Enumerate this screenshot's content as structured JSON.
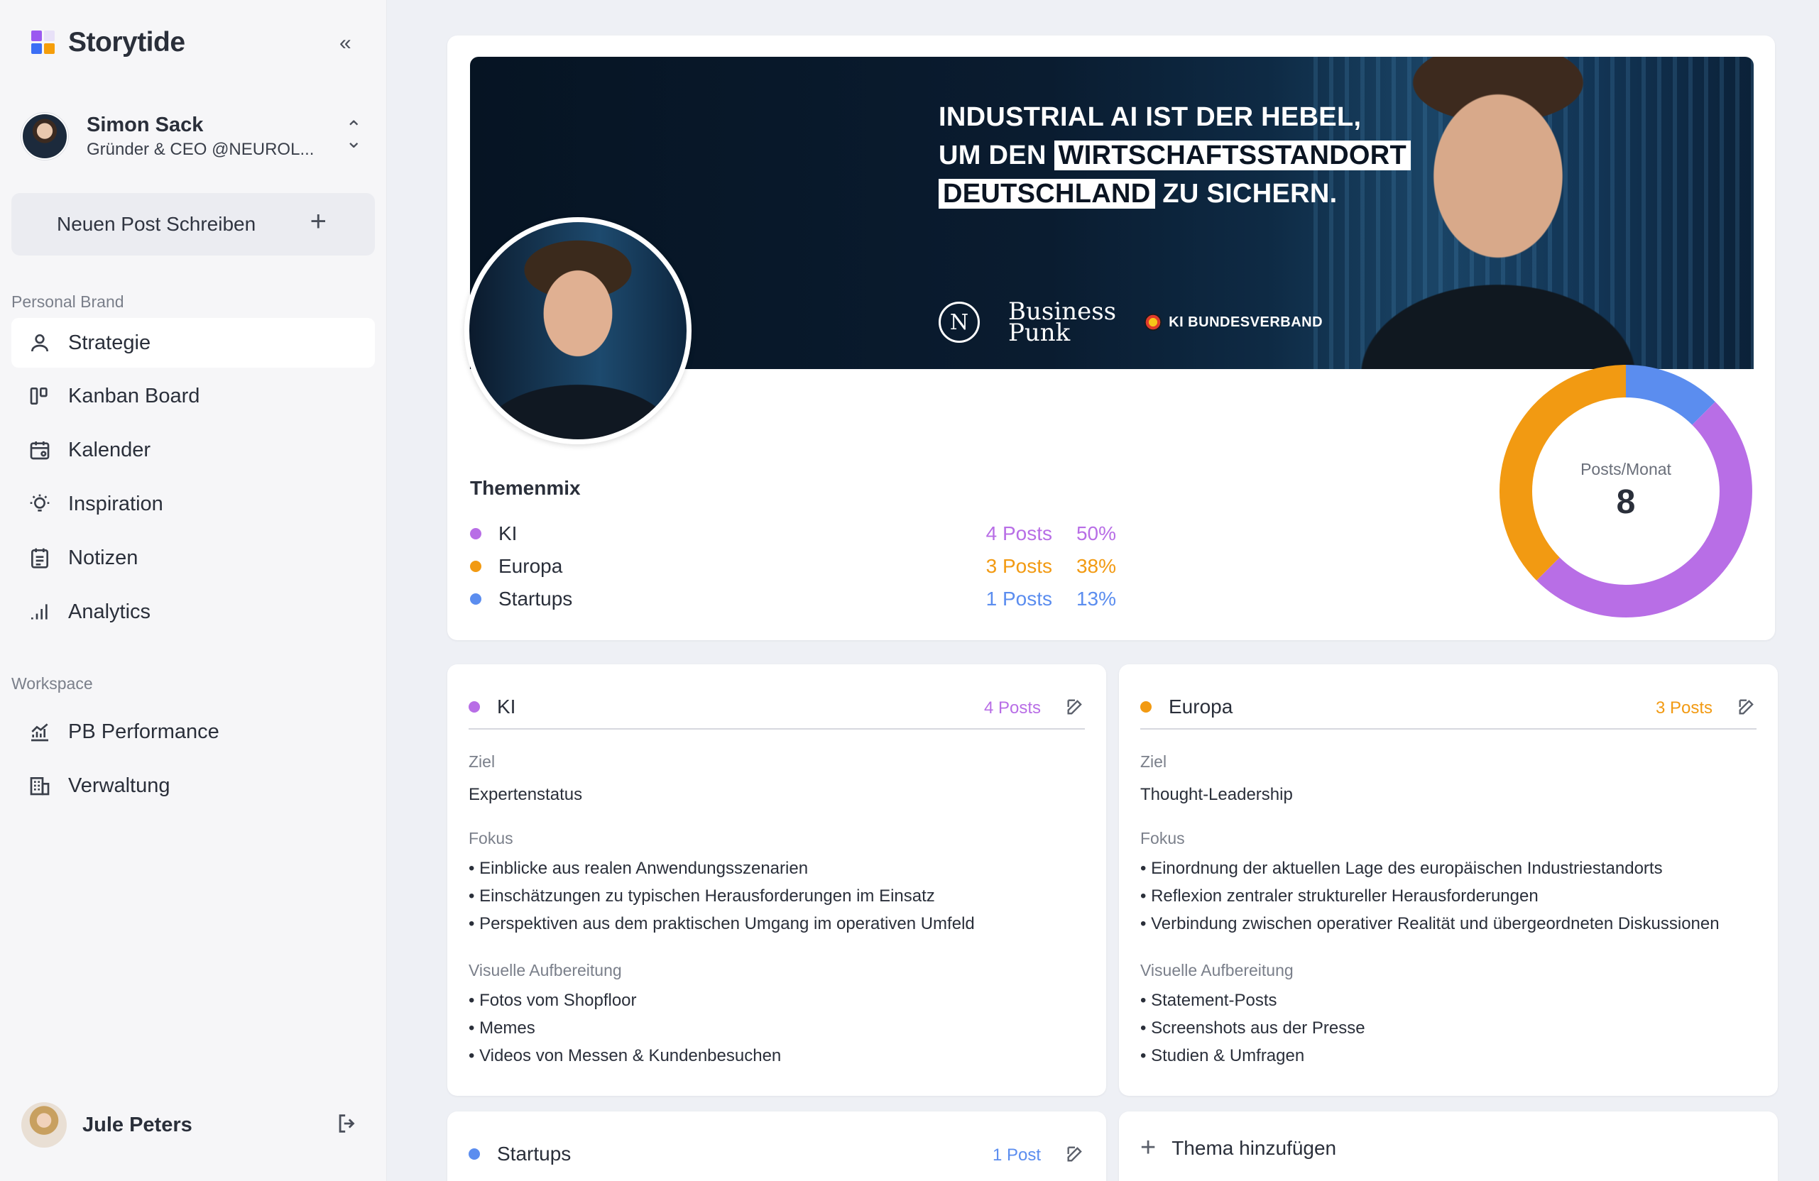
{
  "app": {
    "name": "Storytide"
  },
  "colors": {
    "ki": "#b86ee6",
    "europa": "#f29a12",
    "startups": "#5b8def"
  },
  "user": {
    "name": "Simon Sack",
    "role": "Gründer & CEO @NEUROL..."
  },
  "new_post": {
    "label": "Neuen Post Schreiben"
  },
  "sidebar": {
    "personal_brand_label": "Personal Brand",
    "personal_items": [
      {
        "label": "Strategie",
        "icon": "user-icon"
      },
      {
        "label": "Kanban Board",
        "icon": "kanban-icon"
      },
      {
        "label": "Kalender",
        "icon": "calendar-icon"
      },
      {
        "label": "Inspiration",
        "icon": "lightbulb-icon"
      },
      {
        "label": "Notizen",
        "icon": "notes-icon"
      },
      {
        "label": "Analytics",
        "icon": "bar-chart-icon"
      }
    ],
    "workspace_label": "Workspace",
    "workspace_items": [
      {
        "label": "PB Performance",
        "icon": "performance-chart-icon"
      },
      {
        "label": "Verwaltung",
        "icon": "building-icon"
      }
    ]
  },
  "footer_user": {
    "name": "Jule Peters"
  },
  "banner": {
    "line1": "INDUSTRIAL AI IST DER HEBEL,",
    "line2_plain": "UM DEN",
    "line2_highlight": "WIRTSCHAFTSSTANDORT",
    "line3_highlight": "DEUTSCHLAND",
    "line3_plain": "ZU SICHERN.",
    "logo_n": "N",
    "logo_bp_1": "Business",
    "logo_bp_2": "Punk",
    "logo_ki": "KI BUNDESVERBAND"
  },
  "themenmix": {
    "title": "Themenmix",
    "rows": [
      {
        "name": "KI",
        "posts": "4 Posts",
        "pct": "50%"
      },
      {
        "name": "Europa",
        "posts": "3 Posts",
        "pct": "38%"
      },
      {
        "name": "Startups",
        "posts": "1 Posts",
        "pct": "13%"
      }
    ]
  },
  "donut": {
    "label": "Posts/Monat",
    "value": "8",
    "segments": [
      {
        "name": "Startups",
        "value": 1,
        "color": "#5b8def"
      },
      {
        "name": "KI",
        "value": 4,
        "color": "#b86ee6"
      },
      {
        "name": "Europa",
        "value": 3,
        "color": "#f29a12"
      }
    ]
  },
  "topics": {
    "field_labels": {
      "ziel": "Ziel",
      "fokus": "Fokus",
      "visual": "Visuelle Aufbereitung"
    },
    "ki": {
      "title": "KI",
      "count": "4 Posts",
      "ziel": "Expertenstatus",
      "fokus": [
        "Einblicke aus realen Anwendungsszenarien",
        "Einschätzungen zu typischen Herausforderungen im Einsatz",
        "Perspektiven aus dem praktischen Umgang im operativen Umfeld"
      ],
      "visual": [
        "Fotos vom Shopfloor",
        "Memes",
        "Videos von Messen & Kundenbesuchen"
      ]
    },
    "europa": {
      "title": "Europa",
      "count": "3 Posts",
      "ziel": "Thought-Leadership",
      "fokus": [
        "Einordnung der aktuellen Lage des europäischen Industriestandorts",
        "Reflexion zentraler struktureller Herausforderungen",
        "Verbindung zwischen operativer Realität und übergeordneten Diskussionen"
      ],
      "visual": [
        "Statement-Posts",
        "Screenshots aus der Presse",
        "Studien & Umfragen"
      ]
    },
    "startups": {
      "title": "Startups",
      "count": "1 Post"
    },
    "add_label": "Thema hinzufügen"
  }
}
